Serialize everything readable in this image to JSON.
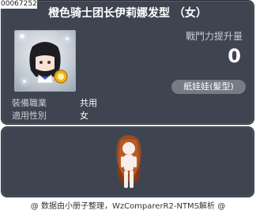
{
  "item_id": "00067252",
  "title": "橙色骑士团长伊莉娜发型 （女）",
  "power": {
    "label": "戰鬥力提升量",
    "value": "0"
  },
  "category_pill": "紙娃娃(髮型)",
  "details": {
    "job_label": "裝備職業",
    "job_value": "共用",
    "gender_label": "適用性別",
    "gender_value": "女"
  },
  "footer": "@ 数据由小册子整理，WzComparerR2-NTMS解析 @",
  "colors": {
    "panel_bg": "#3f4451",
    "pill_bg": "#767b86",
    "hair": "#9b4a22"
  }
}
